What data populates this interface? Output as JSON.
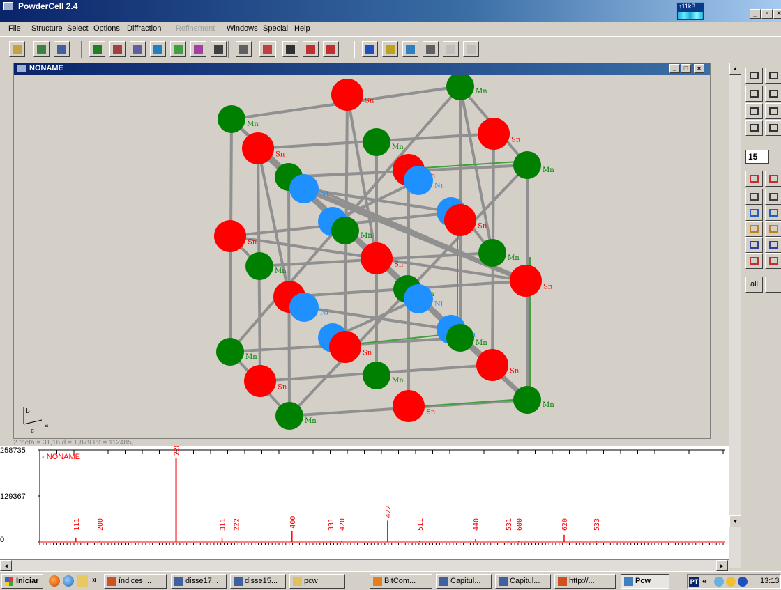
{
  "window": {
    "title": "PowderCell 2.4",
    "net_rate": "↑11kB"
  },
  "menu": [
    "File",
    "Structure",
    "Select",
    "Options",
    "Diffraction",
    "Refinement",
    "Windows",
    "Special",
    "Help"
  ],
  "menu_disabled": [
    "Refinement"
  ],
  "toolbar_icons": [
    "open-icon",
    "new-structure-icon",
    "clipboard-icon",
    "target-icon",
    "tools-icon",
    "edit-structure-icon",
    "graph-icon",
    "edit-icon",
    "rotate-icon",
    "delta-x-icon",
    "hkl-icon",
    "cell-icon",
    "print-icon",
    "print-preview-icon",
    "print-setup-icon",
    "sphere-icon",
    "atom-pair-icon",
    "colors-icon",
    "table-icon",
    "disabled-grid-icon",
    "disabled-pattern-icon"
  ],
  "structure_window": {
    "title": "NONAME"
  },
  "axis_labels": {
    "b": "b",
    "c": "c",
    "a": "a"
  },
  "atom_colors": {
    "Sn": "#ff0000",
    "Mn": "#008000",
    "Ni": "#1e90ff"
  },
  "right_panel": {
    "spin_value": "15",
    "all_label": "all"
  },
  "readout_text": "2 theta = 31,16      d = 1,879      Int = 112485,",
  "pattern": {
    "title": "NONAME",
    "y_ticks": [
      "258735",
      "129367",
      "0"
    ],
    "ymax": 258735,
    "xlim": [
      20,
      100
    ],
    "color": "#ff0000",
    "peaks": [
      {
        "hkl": "111",
        "x": 26.2,
        "i": 12000
      },
      {
        "hkl": "200",
        "x": 30.3,
        "i": 4000
      },
      {
        "hkl": "220",
        "x": 43.4,
        "i": 235000
      },
      {
        "hkl": "311",
        "x": 51.3,
        "i": 10000
      },
      {
        "hkl": "222",
        "x": 53.7,
        "i": 3000
      },
      {
        "hkl": "400",
        "x": 63.3,
        "i": 30000
      },
      {
        "hkl": "331",
        "x": 69.9,
        "i": 2000
      },
      {
        "hkl": "420",
        "x": 71.8,
        "i": 2000
      },
      {
        "hkl": "422",
        "x": 79.7,
        "i": 60000
      },
      {
        "hkl": "511",
        "x": 85.2,
        "i": 3000
      },
      {
        "hkl": "440",
        "x": 94.8,
        "i": 8000
      },
      {
        "hkl": "531",
        "x": 100.4,
        "i": 2000
      },
      {
        "hkl": "600",
        "x": 102.2,
        "i": 2000
      },
      {
        "hkl": "620",
        "x": 110.0,
        "i": 20000
      },
      {
        "hkl": "533",
        "x": 115.5,
        "i": 2000
      }
    ]
  },
  "taskbar": {
    "start": "Iniciar",
    "tasks": [
      "índices ...",
      "disse17...",
      "disse15...",
      "pcw",
      "BitCom...",
      "Capitul...",
      "Capitul...",
      "http://...",
      "Pcw"
    ],
    "active_task": "Pcw",
    "lang": "PT",
    "clock": "13:13"
  }
}
